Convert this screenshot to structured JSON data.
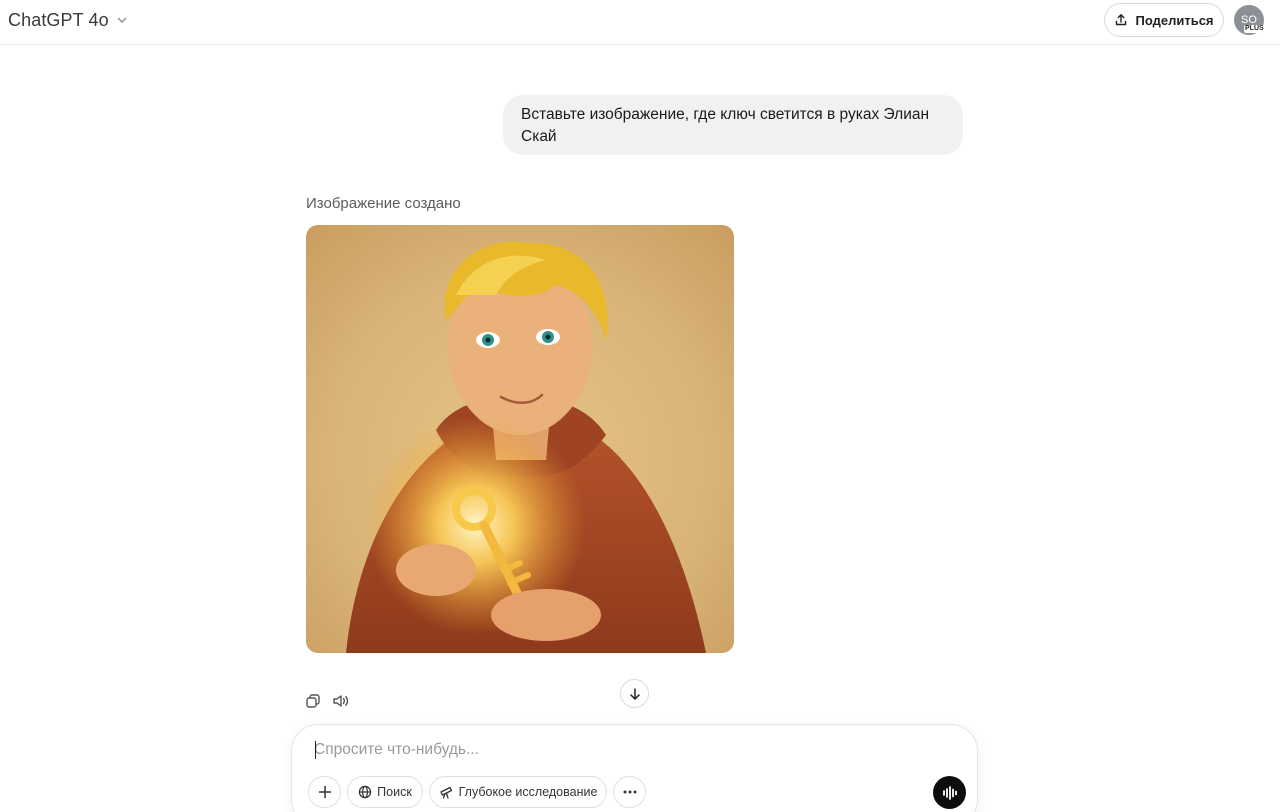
{
  "header": {
    "model_name": "ChatGPT 4o",
    "share_label": "Поделиться",
    "avatar_initials": "SO",
    "avatar_tag": "PLUS"
  },
  "conversation": {
    "user_message": "Вставьте изображение, где ключ светится в  руках Элиан Скай",
    "assistant_status": "Изображение создано",
    "image_description_icon": "generated-image"
  },
  "composer": {
    "placeholder": "Спросите что-нибудь...",
    "tools": {
      "search_label": "Поиск",
      "deep_research_label": "Глубокое исследование"
    }
  },
  "colors": {
    "accent": "#0d0d0d",
    "bubble": "#f1f1f1",
    "avatar": "#8c9197"
  },
  "icons": [
    "chevron-down-icon",
    "share-icon",
    "copy-icon",
    "speaker-icon",
    "arrow-down-icon",
    "plus-icon",
    "globe-icon",
    "telescope-icon",
    "more-icon",
    "voice-icon"
  ]
}
